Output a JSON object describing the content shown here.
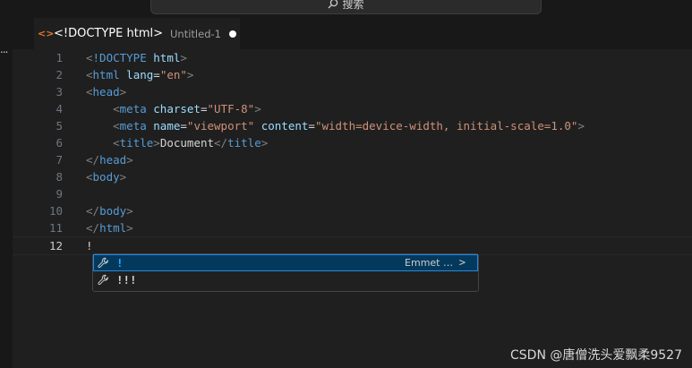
{
  "titlebar": {
    "search_label": "搜索"
  },
  "activity": {
    "more_label": "..."
  },
  "tab": {
    "icon": "<>",
    "title": "<!DOCTYPE html>",
    "description": "Untitled-1"
  },
  "lines": [
    {
      "n": "1",
      "tokens": [
        [
          "br",
          "<"
        ],
        [
          "tag",
          "!DOCTYPE"
        ],
        [
          "text",
          " "
        ],
        [
          "attr",
          "html"
        ],
        [
          "br",
          ">"
        ]
      ]
    },
    {
      "n": "2",
      "tokens": [
        [
          "br",
          "<"
        ],
        [
          "tag",
          "html"
        ],
        [
          "text",
          " "
        ],
        [
          "attr",
          "lang"
        ],
        [
          "text",
          "="
        ],
        [
          "str",
          "\"en\""
        ],
        [
          "br",
          ">"
        ]
      ]
    },
    {
      "n": "3",
      "tokens": [
        [
          "br",
          "<"
        ],
        [
          "tag",
          "head"
        ],
        [
          "br",
          ">"
        ]
      ]
    },
    {
      "n": "4",
      "tokens": [
        [
          "text",
          "    "
        ],
        [
          "br",
          "<"
        ],
        [
          "tag",
          "meta"
        ],
        [
          "text",
          " "
        ],
        [
          "attr",
          "charset"
        ],
        [
          "text",
          "="
        ],
        [
          "str",
          "\"UTF-8\""
        ],
        [
          "br",
          ">"
        ]
      ]
    },
    {
      "n": "5",
      "tokens": [
        [
          "text",
          "    "
        ],
        [
          "br",
          "<"
        ],
        [
          "tag",
          "meta"
        ],
        [
          "text",
          " "
        ],
        [
          "attr",
          "name"
        ],
        [
          "text",
          "="
        ],
        [
          "str",
          "\"viewport\""
        ],
        [
          "text",
          " "
        ],
        [
          "attr",
          "content"
        ],
        [
          "text",
          "="
        ],
        [
          "str",
          "\"width=device-width, initial-scale=1.0\""
        ],
        [
          "br",
          ">"
        ]
      ]
    },
    {
      "n": "6",
      "tokens": [
        [
          "text",
          "    "
        ],
        [
          "br",
          "<"
        ],
        [
          "tag",
          "title"
        ],
        [
          "br",
          ">"
        ],
        [
          "text",
          "Document"
        ],
        [
          "br",
          "</"
        ],
        [
          "tag",
          "title"
        ],
        [
          "br",
          ">"
        ]
      ]
    },
    {
      "n": "7",
      "tokens": [
        [
          "br",
          "</"
        ],
        [
          "tag",
          "head"
        ],
        [
          "br",
          ">"
        ]
      ]
    },
    {
      "n": "8",
      "tokens": [
        [
          "br",
          "<"
        ],
        [
          "tag",
          "body"
        ],
        [
          "br",
          ">"
        ]
      ]
    },
    {
      "n": "9",
      "tokens": []
    },
    {
      "n": "10",
      "tokens": [
        [
          "br",
          "</"
        ],
        [
          "tag",
          "body"
        ],
        [
          "br",
          ">"
        ]
      ]
    },
    {
      "n": "11",
      "tokens": [
        [
          "br",
          "</"
        ],
        [
          "tag",
          "html"
        ],
        [
          "br",
          ">"
        ]
      ]
    },
    {
      "n": "12",
      "tokens": [
        [
          "text",
          "!"
        ]
      ],
      "active": true
    }
  ],
  "suggestions": [
    {
      "label": "!",
      "detail": "Emmet …",
      "chevron": ">",
      "selected": true,
      "icon": "wrench-icon"
    },
    {
      "label": "!!!",
      "selected": false,
      "icon": "wrench-icon"
    }
  ],
  "watermark": "CSDN @唐僧洗头爱飘柔9527",
  "colors": {
    "tag": "#569cd6",
    "attr": "#9cdcfe",
    "string": "#ce9178",
    "bracket": "#808080",
    "selection": "#04395e",
    "focus": "#2488db"
  }
}
